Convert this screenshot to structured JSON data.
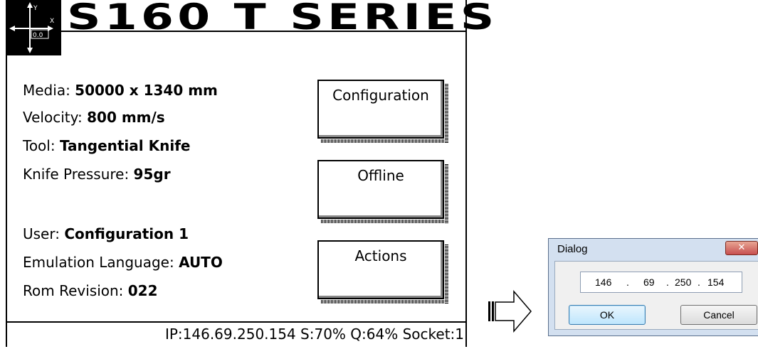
{
  "device": {
    "title": "S160 T SERIES",
    "info": [
      {
        "label": "Media: ",
        "value": "50000 x 1340 mm"
      },
      {
        "label": "Velocity: ",
        "value": "800 mm/s"
      },
      {
        "label": "Tool: ",
        "value": "Tangential Knife"
      },
      {
        "label": "Knife Pressure: ",
        "value": "95gr"
      },
      {
        "label": "User: ",
        "value": "Configuration 1"
      },
      {
        "label": "Emulation Language: ",
        "value": "AUTO"
      },
      {
        "label": "Rom Revision: ",
        "value": "022"
      }
    ],
    "buttons": {
      "configuration": "Configuration",
      "offline": "Offline",
      "actions": "Actions"
    },
    "status": "IP:146.69.250.154 S:70% Q:64% Socket:1",
    "logo": {
      "axis_y": "Y",
      "axis_x": "X",
      "origin": "0.0"
    }
  },
  "dialog": {
    "title": "Dialog",
    "close": "✕",
    "ip": [
      "146",
      ".",
      "69",
      ".",
      "250",
      ".",
      "154"
    ],
    "ok": "OK",
    "cancel": "Cancel"
  }
}
